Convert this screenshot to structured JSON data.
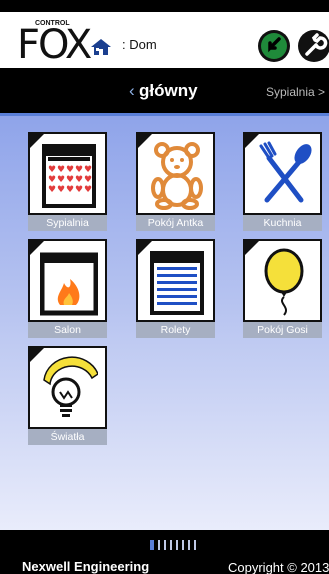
{
  "header": {
    "logo_text": "FOX",
    "logo_sub": "CONTROL",
    "home_label": ": Dom",
    "back_icon": "back-arrow-icon",
    "settings_icon": "wrench-icon"
  },
  "nav": {
    "back_marker": "‹",
    "current": "główny",
    "next": "Sypialnia",
    "next_marker": ">"
  },
  "tiles": [
    {
      "label": "Sypialnia",
      "icon": "bed-icon"
    },
    {
      "label": "Pokój Antka",
      "icon": "teddy-bear-icon"
    },
    {
      "label": "Kuchnia",
      "icon": "fork-spoon-icon"
    },
    {
      "label": "Salon",
      "icon": "fireplace-icon"
    },
    {
      "label": "Rolety",
      "icon": "blinds-icon"
    },
    {
      "label": "Pokój Gosi",
      "icon": "balloon-icon"
    },
    {
      "label": "Światła",
      "icon": "lightbulb-icon"
    }
  ],
  "footer": {
    "company": "Nexwell Engineering",
    "copyright": "Copyright © 2013"
  },
  "colors": {
    "accent": "#5a7fd8",
    "bed_hearts": "#e23b3b",
    "teddy": "#e08a3a",
    "fork_spoon": "#1f4fc4",
    "fire": "#ff7a1a",
    "balloon": "#f5e03a"
  }
}
